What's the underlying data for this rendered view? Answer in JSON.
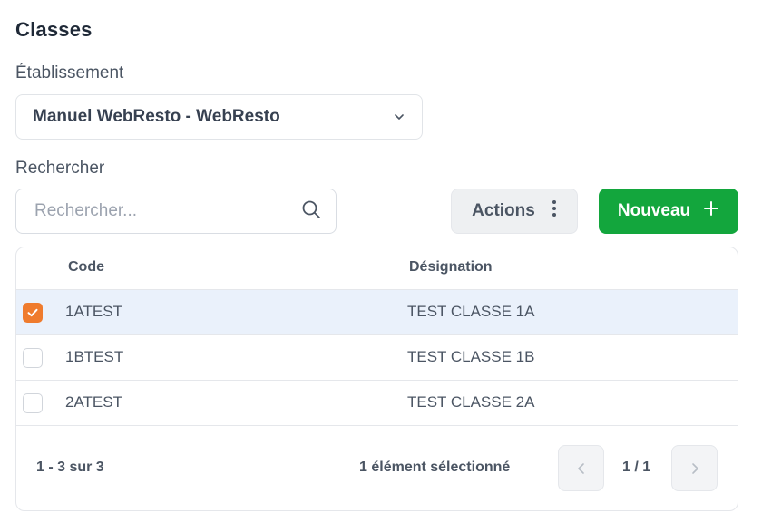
{
  "page": {
    "title": "Classes"
  },
  "establishment": {
    "label": "Établissement",
    "value": "Manuel WebResto - WebResto"
  },
  "search": {
    "label": "Rechercher",
    "placeholder": "Rechercher..."
  },
  "toolbar": {
    "actions_label": "Actions",
    "new_label": "Nouveau"
  },
  "table": {
    "columns": [
      "Code",
      "Désignation"
    ],
    "rows": [
      {
        "code": "1ATEST",
        "designation": "TEST CLASSE 1A",
        "selected": true
      },
      {
        "code": "1BTEST",
        "designation": "TEST CLASSE 1B",
        "selected": false
      },
      {
        "code": "2ATEST",
        "designation": "TEST CLASSE 2A",
        "selected": false
      }
    ]
  },
  "footer": {
    "range": "1 - 3 sur 3",
    "selection": "1 élément sélectionné",
    "page": "1 / 1"
  },
  "colors": {
    "primary_green": "#13a63d",
    "checkbox_orange": "#ef7b2d",
    "selected_row": "#eaf1fb"
  },
  "icons": {
    "select": "chevron-down-icon",
    "search": "search-icon",
    "actions": "more-vertical-icon",
    "new": "plus-icon",
    "prev": "chevron-left-icon",
    "next": "chevron-right-icon",
    "check": "check-icon"
  }
}
